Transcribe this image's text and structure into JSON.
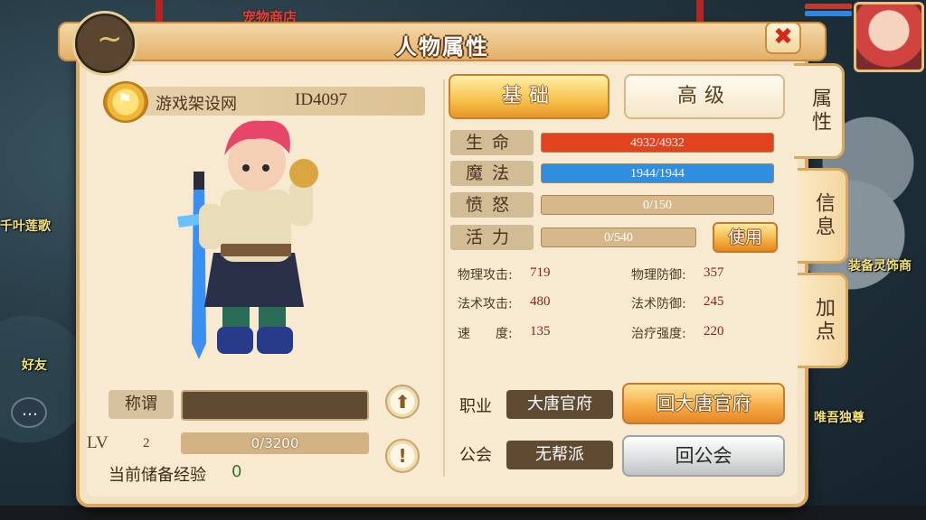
{
  "window": {
    "title": "人物属性",
    "close_icon": "✖"
  },
  "background": {
    "shop_text": "宠物商店",
    "lotus_text": "千叶莲歌",
    "equip_text": "装备灵饰商",
    "friend_text": "好友",
    "unique_text": "唯吾独尊"
  },
  "player": {
    "name": "游戏架设网",
    "id": "ID4097",
    "level_label": "LV",
    "level": "2",
    "exp": "0/3200",
    "exp_fraction": 0,
    "stored_exp_label": "当前储备经验",
    "stored_exp": "0",
    "title_label": "称谓",
    "title_value": ""
  },
  "tabs": {
    "basic": "基础",
    "advanced": "高级",
    "active": "basic"
  },
  "stats": [
    {
      "label": "生命",
      "value": "4932/4932",
      "fraction": 1.0,
      "color": "#e2431f"
    },
    {
      "label": "魔法",
      "value": "1944/1944",
      "fraction": 1.0,
      "color": "#2f8ee0"
    },
    {
      "label": "愤怒",
      "value": "0/150",
      "fraction": 0,
      "color": "#d6b88a"
    },
    {
      "label": "活力",
      "value": "0/540",
      "fraction": 0,
      "color": "#d6b88a"
    }
  ],
  "use_button": "使用",
  "attributes": {
    "phys_atk_label": "物理攻击:",
    "phys_atk": "719",
    "phys_def_label": "物理防御:",
    "phys_def": "357",
    "mag_atk_label": "法术攻击:",
    "mag_atk": "480",
    "mag_def_label": "法术防御:",
    "mag_def": "245",
    "speed_label": "速　　度:",
    "speed": "135",
    "heal_label": "治疗强度:",
    "heal": "220"
  },
  "profession": {
    "label": "职业",
    "value": "大唐官府",
    "button": "回大唐官府"
  },
  "guild": {
    "label": "公会",
    "value": "无帮派",
    "button": "回公会"
  },
  "side_tabs": [
    "属性",
    "信息",
    "加点"
  ],
  "colors": {
    "hp": "#e2431f",
    "mp": "#2f8ee0",
    "accent": "#f6c04a"
  }
}
